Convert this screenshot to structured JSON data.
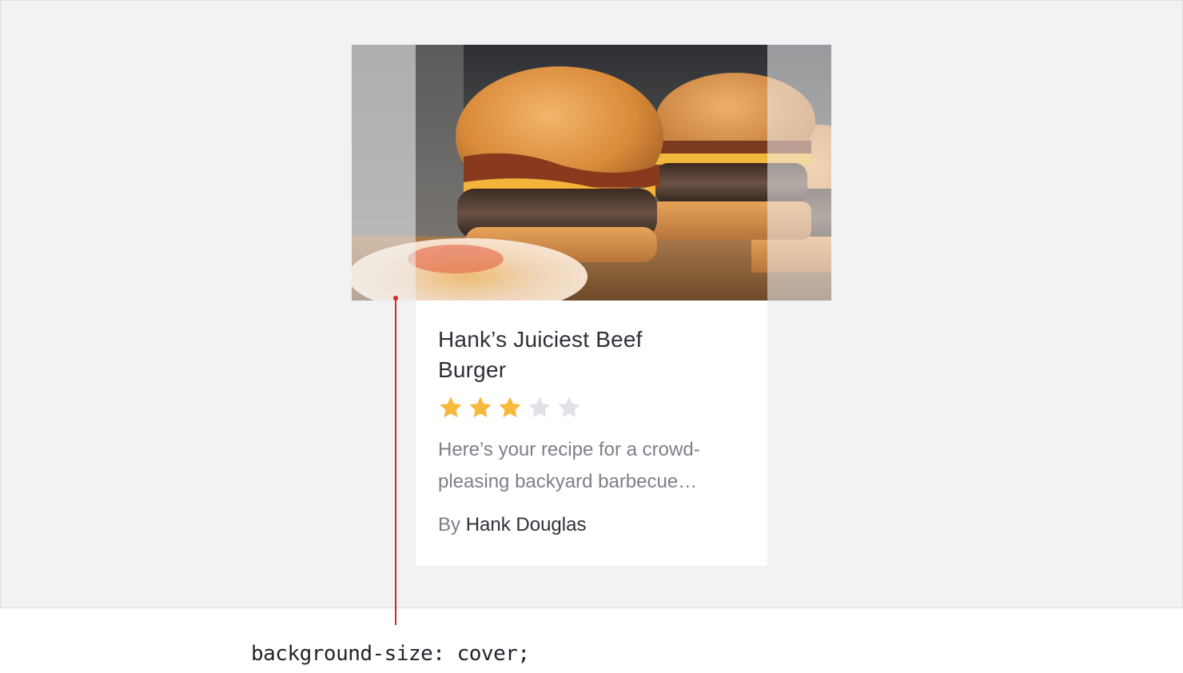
{
  "card": {
    "image_icon": "burger-photo",
    "title": "Hank’s Juiciest Beef Burger",
    "rating": 3,
    "rating_max": 5,
    "description": "Here’s your recipe for a crowd-pleasing backyard barbecue…",
    "byline_prefix": "By",
    "author": "Hank Douglas"
  },
  "annotation": {
    "code": "background-size: cover;"
  },
  "colors": {
    "accent": "#e02424",
    "star_filled": "#f6b93b",
    "star_empty": "#dfe3e8",
    "title_text": "#2c3038",
    "muted_text": "#7a8089",
    "stage_background": "#f1f2f4"
  }
}
